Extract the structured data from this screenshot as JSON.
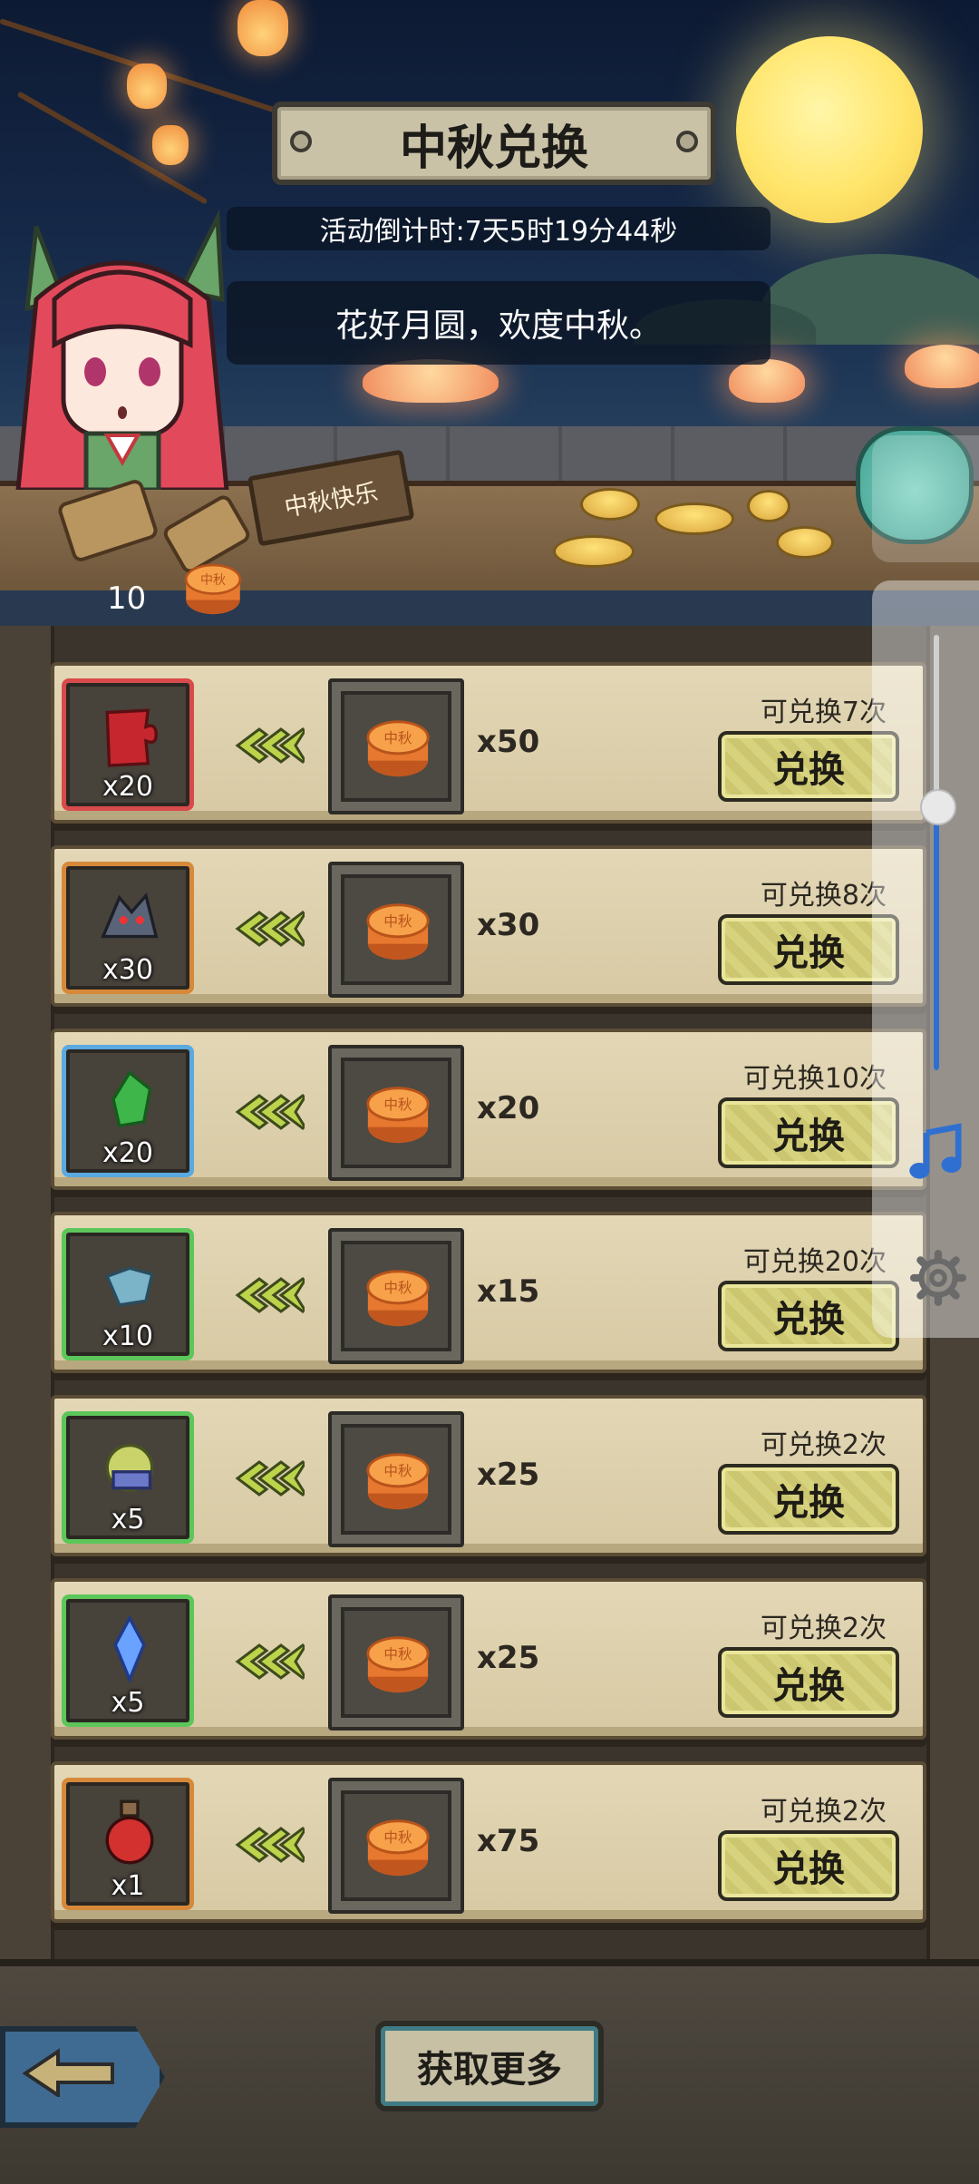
{
  "header": {
    "title": "中秋兑换",
    "countdown": "活动倒计时:7天5时19分44秒",
    "slogan": "花好月圆，欢度中秋。",
    "sign": "中秋快乐",
    "currency_count": "10",
    "currency_icon": "mooncake-icon"
  },
  "exchange_rows": [
    {
      "item_icon": "red-puzzle-piece-icon",
      "item_count": "x20",
      "rarity_color": "#d94a4a",
      "cost": "x50",
      "limit": "可兑换7次",
      "button": "兑换"
    },
    {
      "item_icon": "wolf-character-icon",
      "item_count": "x30",
      "rarity_color": "#d6893a",
      "cost": "x30",
      "limit": "可兑换8次",
      "button": "兑换"
    },
    {
      "item_icon": "green-crystal-icon",
      "item_count": "x20",
      "rarity_color": "#5aa9e0",
      "cost": "x20",
      "limit": "可兑换10次",
      "button": "兑换"
    },
    {
      "item_icon": "blue-ore-icon",
      "item_count": "x10",
      "rarity_color": "#5cc65a",
      "cost": "x15",
      "limit": "可兑换20次",
      "button": "兑换"
    },
    {
      "item_icon": "gem-gear-icon",
      "item_count": "x5",
      "rarity_color": "#5cc65a",
      "cost": "x25",
      "limit": "可兑换2次",
      "button": "兑换"
    },
    {
      "item_icon": "blue-crystal-shard-icon",
      "item_count": "x5",
      "rarity_color": "#5cc65a",
      "cost": "x25",
      "limit": "可兑换2次",
      "button": "兑换"
    },
    {
      "item_icon": "red-potion-icon",
      "item_count": "x1",
      "rarity_color": "#d6893a",
      "cost": "x75",
      "limit": "可兑换2次",
      "button": "兑换"
    }
  ],
  "footer": {
    "more_button": "获取更多",
    "back_icon": "back-arrow-icon"
  },
  "side_panel": {
    "music_icon": "music-note-icon",
    "settings_icon": "gear-icon",
    "bag_icon": "lucky-bag-icon"
  }
}
